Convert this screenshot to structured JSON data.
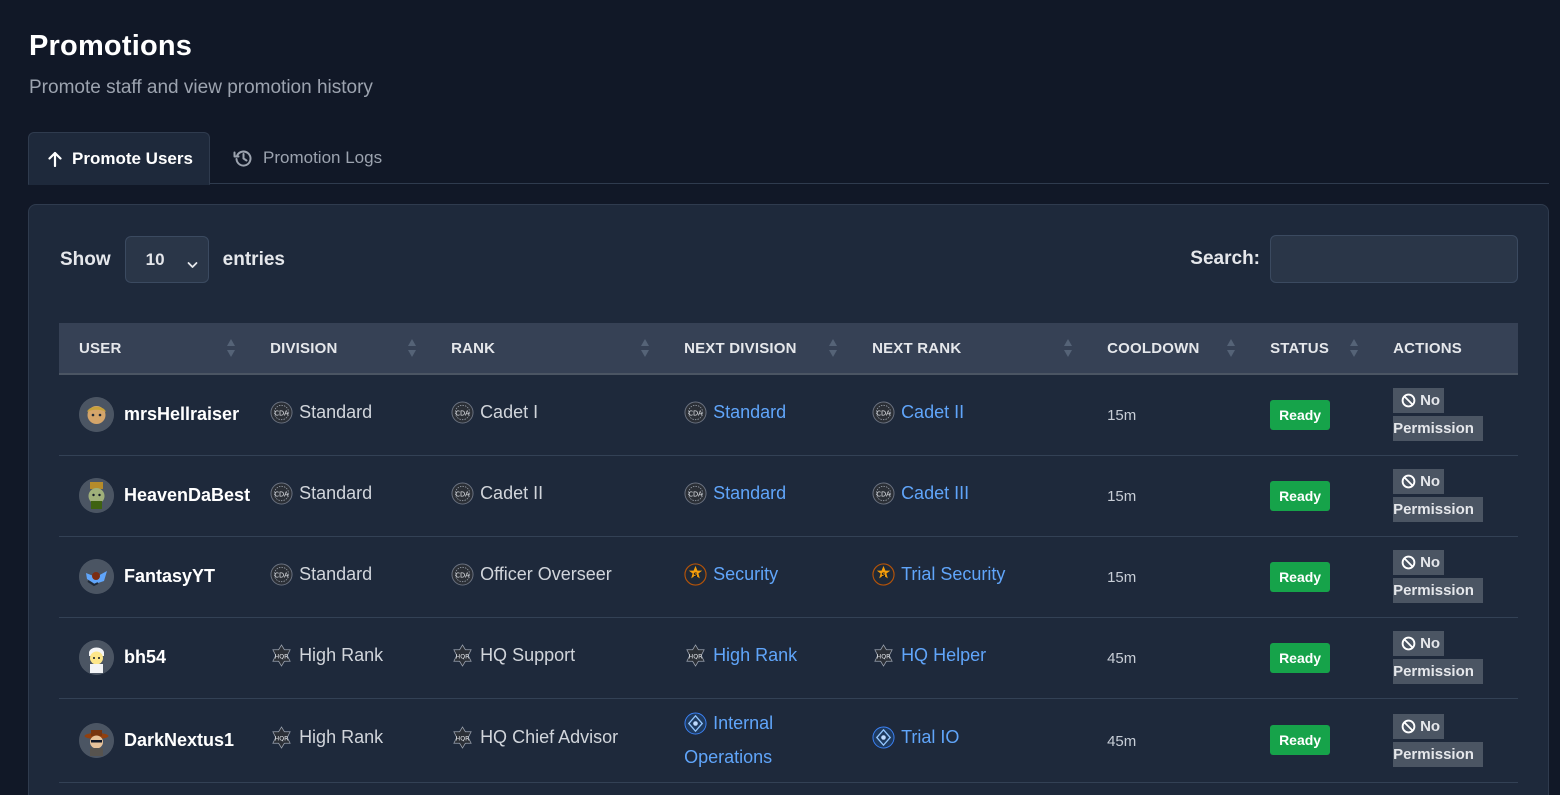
{
  "header": {
    "title": "Promotions",
    "subtitle": "Promote staff and view promotion history"
  },
  "tabs": [
    {
      "label": "Promote Users",
      "icon": "arrow-up-icon",
      "active": true
    },
    {
      "label": "Promotion Logs",
      "icon": "history-icon",
      "active": false
    }
  ],
  "controls": {
    "show_label": "Show",
    "entries_value": "10",
    "entries_label": "entries",
    "search_label": "Search:",
    "search_value": ""
  },
  "table": {
    "columns": [
      "USER",
      "DIVISION",
      "RANK",
      "NEXT DIVISION",
      "NEXT RANK",
      "COOLDOWN",
      "STATUS",
      "ACTIONS"
    ],
    "no_permission": {
      "line1": "No",
      "line2": "Permission",
      "icon": "ban-icon"
    },
    "rows": [
      {
        "user": "mrsHellraiser",
        "division": "Standard",
        "rank": "Cadet I",
        "next_division": "Standard",
        "next_rank": "Cadet II",
        "cooldown": "15m",
        "status": "Ready"
      },
      {
        "user": "HeavenDaBest",
        "division": "Standard",
        "rank": "Cadet II",
        "next_division": "Standard",
        "next_rank": "Cadet III",
        "cooldown": "15m",
        "status": "Ready"
      },
      {
        "user": "FantasyYT",
        "division": "Standard",
        "rank": "Officer Overseer",
        "next_division": "Security",
        "next_rank": "Trial Security",
        "cooldown": "15m",
        "status": "Ready"
      },
      {
        "user": "bh54",
        "division": "High Rank",
        "rank": "HQ Support",
        "next_division": "High Rank",
        "next_rank": "HQ Helper",
        "cooldown": "45m",
        "status": "Ready"
      },
      {
        "user": "DarkNextus1",
        "division": "High Rank",
        "rank": "HQ Chief Advisor",
        "next_division_line1": "Internal",
        "next_division_line2": "Operations",
        "next_rank": "Trial IO",
        "cooldown": "45m",
        "status": "Ready"
      }
    ]
  },
  "colors": {
    "background": "#111827",
    "card": "#1e293b",
    "header_row": "#364155",
    "link": "#60a5fa",
    "ready": "#16a34a",
    "no_permission": "#4b5563"
  }
}
